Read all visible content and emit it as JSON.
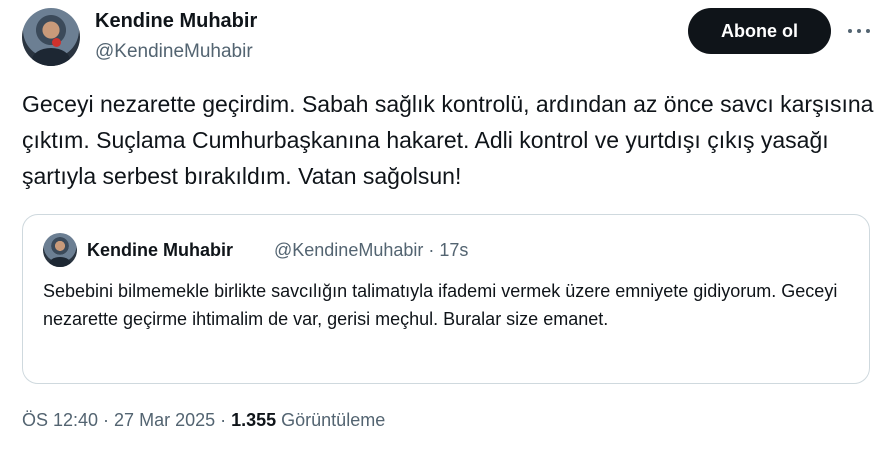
{
  "author": {
    "name": "Kendine Muhabir",
    "handle": "@KendineMuhabir"
  },
  "follow_button_label": "Abone ol",
  "more_icon": "more-horizontal-icon",
  "tweet_text": "Geceyi nezarette geçirdim. Sabah sağlık kontrolü, ardından az önce savcı karşısına çıktım. Suçlama Cumhurbaşkanına hakaret. Adli kontrol ve yurtdışı çıkış yasağı şartıyla serbest bırakıldım. Vatan sağolsun!",
  "quoted_tweet": {
    "name": "Kendine Muhabir",
    "meta": "@KendineMuhabir · 17s",
    "text": "Sebebini bilmemekle birlikte savcılığın talimatıyla ifademi vermek üzere emniyete gidiyorum. Geceyi nezarette geçirme ihtimalim de var, gerisi meçhul. Buralar size emanet."
  },
  "footer": {
    "timestamp": "ÖS 12:40 · 27 Mar 2025 · ",
    "views_count": "1.355",
    "views_label": " Görüntüleme"
  },
  "colors": {
    "text_primary": "#0f1419",
    "text_secondary": "#536471",
    "border": "#cfd9de",
    "button_bg": "#0f1419"
  }
}
